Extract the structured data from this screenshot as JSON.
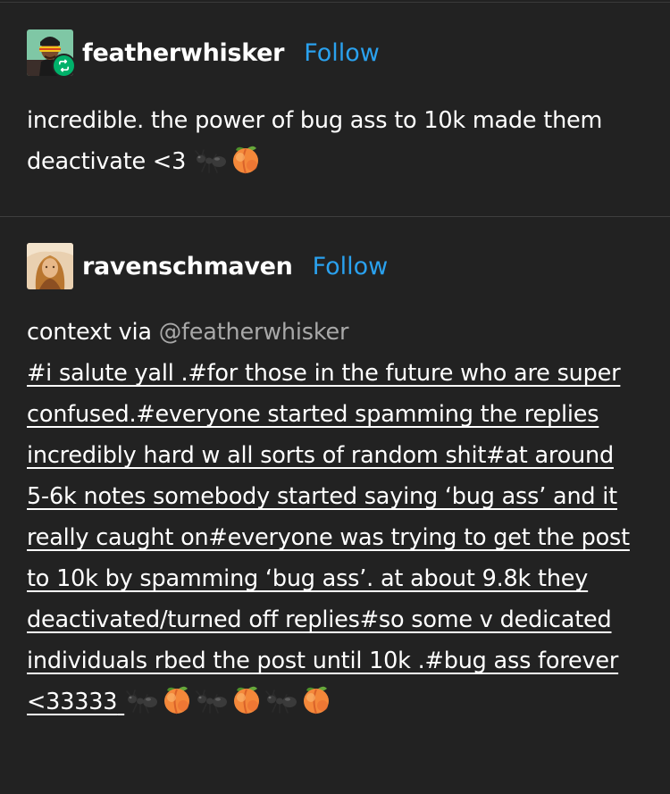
{
  "posts": [
    {
      "username": "featherwhisker",
      "follow_label": "Follow",
      "is_reblog": true,
      "avatar_icon": "user-avatar-sunglasses",
      "text": "incredible. the power of bug ass to 10k made them deactivate <3",
      "emoji": [
        "ant",
        "peach"
      ]
    },
    {
      "username": "ravenschmaven",
      "follow_label": "Follow",
      "is_reblog": false,
      "avatar_icon": "user-avatar-painting",
      "context_prefix": "context via ",
      "mention": "@featherwhisker",
      "tags_text": "#i salute yall .#for those in the future who are super confused.#everyone started spamming the replies incredibly hard w all sorts of random shit#at around 5-6k notes somebody started saying ‘bug ass’ and it really caught on#everyone was trying to get the post to 10k by spamming ‘bug ass’. at about 9.8k they deactivated/turned off replies#so some v dedicated individuals rbed the post until 10k .#bug ass forever <33333",
      "emoji": [
        "ant",
        "peach",
        "ant",
        "peach",
        "ant",
        "peach"
      ]
    }
  ],
  "colors": {
    "background": "#222222",
    "text": "#ffffff",
    "follow": "#2aa1ee",
    "mention": "#a8a8a8",
    "reblog_badge": "#00b16a"
  }
}
